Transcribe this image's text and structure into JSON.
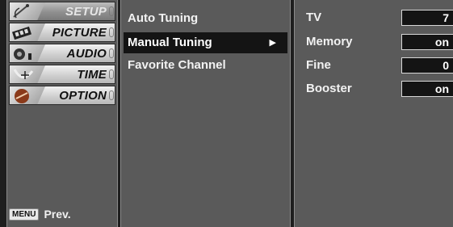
{
  "main_menu": {
    "items": [
      {
        "label": "SETUP",
        "icon": "satellite-dish-icon",
        "selected": true
      },
      {
        "label": "PICTURE",
        "icon": "film-strip-icon",
        "selected": false
      },
      {
        "label": "AUDIO",
        "icon": "speaker-icon",
        "selected": false
      },
      {
        "label": "TIME",
        "icon": "clock-icon",
        "selected": false
      },
      {
        "label": "OPTION",
        "icon": "option-badge-icon",
        "selected": false
      }
    ],
    "footer_key": "MENU",
    "footer_label": "Prev."
  },
  "setup_submenu": {
    "items": [
      {
        "label": "Auto Tuning",
        "selected": false
      },
      {
        "label": "Manual Tuning",
        "selected": true
      },
      {
        "label": "Favorite Channel",
        "selected": false
      }
    ],
    "arrow_icon": "right-triangle-icon"
  },
  "manual_tuning": {
    "rows": [
      {
        "label": "TV",
        "value": "7"
      },
      {
        "label": "Memory",
        "value": "on"
      },
      {
        "label": "Fine",
        "value": "0"
      },
      {
        "label": "Booster",
        "value": "on"
      }
    ]
  },
  "colors": {
    "panel_bg": "#5a5a5a",
    "selected_bg": "#141414",
    "text": "#f2f2f2"
  }
}
